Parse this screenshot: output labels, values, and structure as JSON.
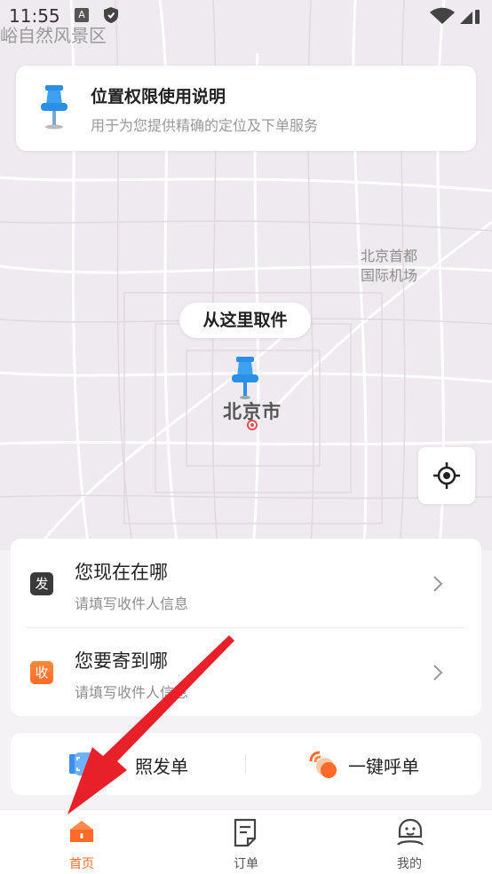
{
  "status_bar": {
    "time": "11:55",
    "badge_a": "A"
  },
  "map": {
    "top_label": "峪自然风景区",
    "airport_label_line1": "北京首都",
    "airport_label_line2": "国际机场",
    "city_label": "北京市",
    "pickup_label": "从这里取件"
  },
  "permission": {
    "title": "位置权限使用说明",
    "subtitle": "用于为您提供精确的定位及下单服务"
  },
  "address": {
    "send": {
      "badge": "发",
      "title": "您现在在哪",
      "subtitle": "请填写收件人信息"
    },
    "receive": {
      "badge": "收",
      "title": "您要寄到哪",
      "subtitle": "请填写收件人信息"
    }
  },
  "actions": {
    "photo_order": "照发单",
    "one_tap_call": "一键呼单"
  },
  "tabs": [
    {
      "label": "首页"
    },
    {
      "label": "订单"
    },
    {
      "label": "我的"
    }
  ],
  "colors": {
    "accent": "#ff6a2a",
    "pin_blue": "#2a8fe6",
    "arrow_red": "#e8202a"
  }
}
